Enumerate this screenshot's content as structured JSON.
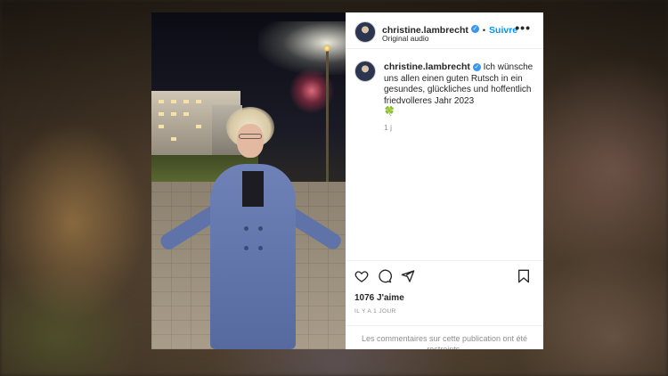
{
  "post": {
    "username": "christine.lambrecht",
    "follow_label": "Suivre",
    "separator": "•",
    "audio_label": "Original audio",
    "caption": "Ich wünsche uns allen einen guten Rutsch in ein gesundes, glückliches und hoffentlich friedvolleres Jahr 2023",
    "caption_emoji": "🍀",
    "caption_age": "1 j",
    "likes": "1076 J'aime",
    "timestamp": "IL Y A 1 JOUR",
    "comments_restricted": "Les commentaires sur cette publication ont été restreints."
  },
  "icons": {
    "verified": "verified-badge-icon",
    "more": "more-options-icon",
    "like": "heart-icon",
    "comment": "comment-icon",
    "share": "share-icon",
    "save": "bookmark-icon"
  },
  "colors": {
    "accent": "#0095f6",
    "verified": "#3897f0",
    "text": "#262626",
    "muted": "#8e8e8e"
  }
}
